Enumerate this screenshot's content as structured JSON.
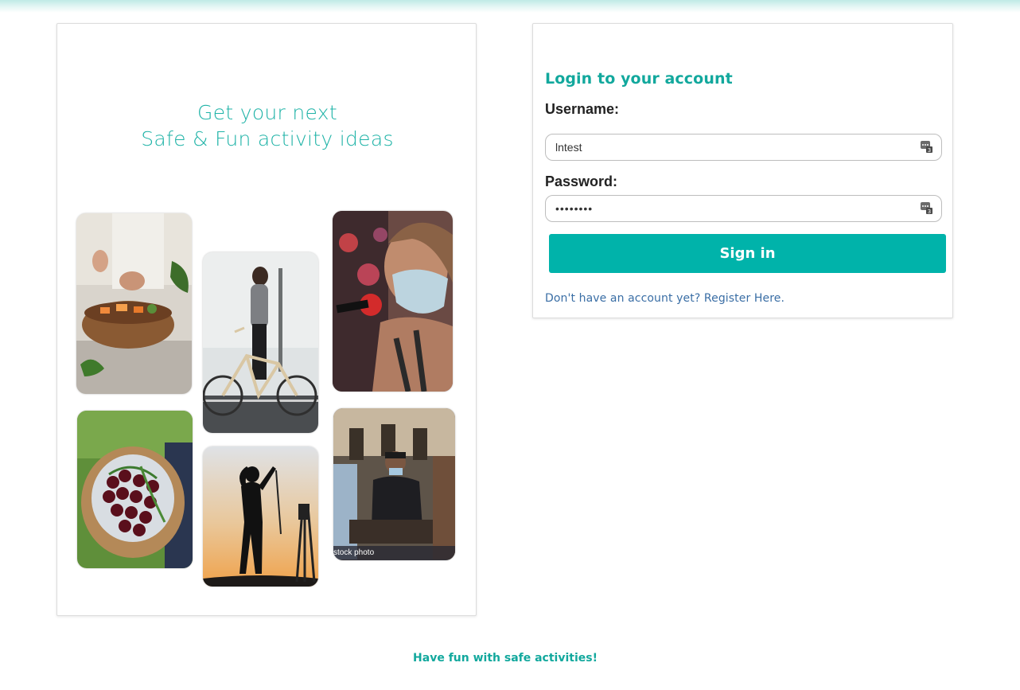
{
  "promo": {
    "title_line1": "Get your next",
    "title_line2": "Safe & Fun activity ideas",
    "photos": [
      {
        "subject": "cooking-hands"
      },
      {
        "subject": "cyclist-woman"
      },
      {
        "subject": "masked-singer"
      },
      {
        "subject": "cherry-basket"
      },
      {
        "subject": "golfer-silhouette"
      },
      {
        "subject": "masked-street-game",
        "caption": "stock photo"
      }
    ]
  },
  "login": {
    "heading": "Login to your account",
    "username_label": "Username:",
    "username_value": "lntest",
    "password_label": "Password:",
    "password_value": "••••••••",
    "signin_label": "Sign in",
    "register_text": "Don't have an account yet? Register Here."
  },
  "footer": {
    "text": "Have fun with safe activities!"
  },
  "colors": {
    "accent": "#00b3aa",
    "heading": "#12a89d",
    "link": "#3a6ea5"
  },
  "icons": {
    "password_manager": "key-badge-icon"
  }
}
